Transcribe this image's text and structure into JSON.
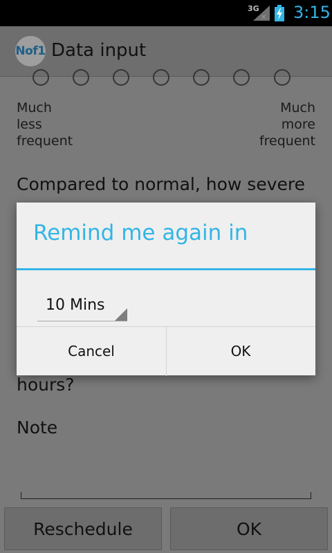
{
  "status_bar": {
    "network": "3G",
    "time": "3:15",
    "accent_color": "#33b5e5"
  },
  "action_bar": {
    "logo_text": "Nof1",
    "title": "Data input"
  },
  "form": {
    "scale_low_label": [
      "Much",
      "less",
      "frequent"
    ],
    "scale_high_label": [
      "Much",
      "more",
      "frequent"
    ],
    "question_severity": "Compared to normal, how severe",
    "question_hours_tail": "hours?",
    "note_label": "Note",
    "note_value": ""
  },
  "dialog": {
    "title": "Remind me again in",
    "selected_option": "10 Mins",
    "cancel_label": "Cancel",
    "ok_label": "OK"
  },
  "footer": {
    "reschedule_label": "Reschedule",
    "ok_label": "OK"
  }
}
